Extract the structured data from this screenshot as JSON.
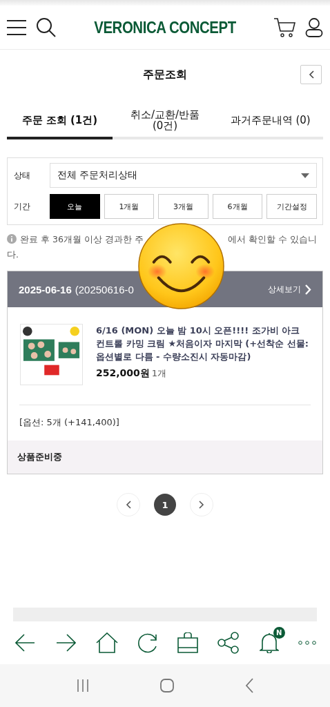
{
  "header": {
    "logo": "VERONICA CONCEPT"
  },
  "page_title": "주문조회",
  "tabs": [
    {
      "label": "주문 조회 (1건)",
      "selected": true
    },
    {
      "label": "취소/교환/반품\n(0건)",
      "selected": false
    },
    {
      "label": "과거주문내역 (0)",
      "selected": false
    }
  ],
  "filter": {
    "status_label": "상태",
    "status_value": "전체 주문처리상태",
    "period_label": "기간",
    "periods": [
      {
        "label": "오늘",
        "selected": true
      },
      {
        "label": "1개월",
        "selected": false
      },
      {
        "label": "3개월",
        "selected": false
      },
      {
        "label": "6개월",
        "selected": false
      },
      {
        "label": "기간설정",
        "selected": false
      }
    ]
  },
  "notice": {
    "before": "완료 후 36개월 이상 경과한 주",
    "after": "에서 확인할 수 있습니다."
  },
  "order": {
    "date": "2025-06-16",
    "number": "(20250616-0",
    "detail_link": "상세보기",
    "product": {
      "kind": "picture",
      "title": "6/16 (MON) 오늘 밤 10시 오픈!!!! 조가비 아크 컨트롤 카밍 크림 ★처음이자 마지막 (+선착순 선물: 옵션별로 다름 - 수량소진시 자동마감)",
      "price": "252,000",
      "currency": "원",
      "quantity": "1개"
    },
    "option": "[옵션: 5개 (+141,400)]",
    "status": "상품준비중"
  },
  "pagination": {
    "pages": [
      {
        "label": "1",
        "selected": true
      }
    ]
  },
  "toolbar": {
    "badge": "N"
  }
}
